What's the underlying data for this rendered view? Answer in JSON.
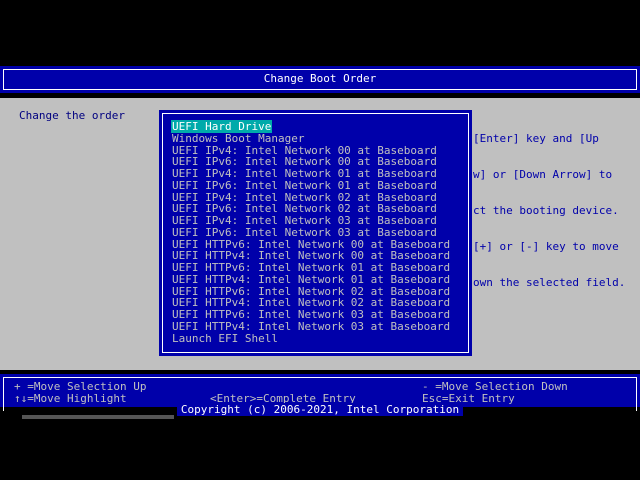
{
  "title": "Change Boot Order",
  "main": {
    "left_label": "Change the order",
    "help_lines": [
      "[Enter] key and [Up",
      "w] or [Down Arrow] to",
      "ct the booting device.",
      "[+] or [-] key to move",
      "own the selected field."
    ]
  },
  "dialog": {
    "items": [
      "UEFI Hard Drive",
      "Windows Boot Manager",
      "UEFI IPv4: Intel Network 00 at Baseboard",
      "UEFI IPv6: Intel Network 00 at Baseboard",
      "UEFI IPv4: Intel Network 01 at Baseboard",
      "UEFI IPv6: Intel Network 01 at Baseboard",
      "UEFI IPv4: Intel Network 02 at Baseboard",
      "UEFI IPv6: Intel Network 02 at Baseboard",
      "UEFI IPv4: Intel Network 03 at Baseboard",
      "UEFI IPv6: Intel Network 03 at Baseboard",
      "UEFI HTTPv6: Intel Network 00 at Baseboard",
      "UEFI HTTPv4: Intel Network 00 at Baseboard",
      "UEFI HTTPv6: Intel Network 01 at Baseboard",
      "UEFI HTTPv4: Intel Network 01 at Baseboard",
      "UEFI HTTPv6: Intel Network 02 at Baseboard",
      "UEFI HTTPv4: Intel Network 02 at Baseboard",
      "UEFI HTTPv6: Intel Network 03 at Baseboard",
      "UEFI HTTPv4: Intel Network 03 at Baseboard",
      "Launch EFI Shell"
    ],
    "selected_index": 0
  },
  "hints": {
    "move_up": "+ =Move Selection Up",
    "move_highlight": "↑↓=Move Highlight",
    "complete_entry": "<Enter>=Complete Entry",
    "move_down": "- =Move Selection Down",
    "exit_entry": "Esc=Exit Entry"
  },
  "copyright": "Copyright (c) 2006-2021, Intel Corporation",
  "colors": {
    "bios_blue": "#0000aa",
    "panel_gray": "#c0c0c0",
    "highlight_cyan": "#00aaaa"
  }
}
